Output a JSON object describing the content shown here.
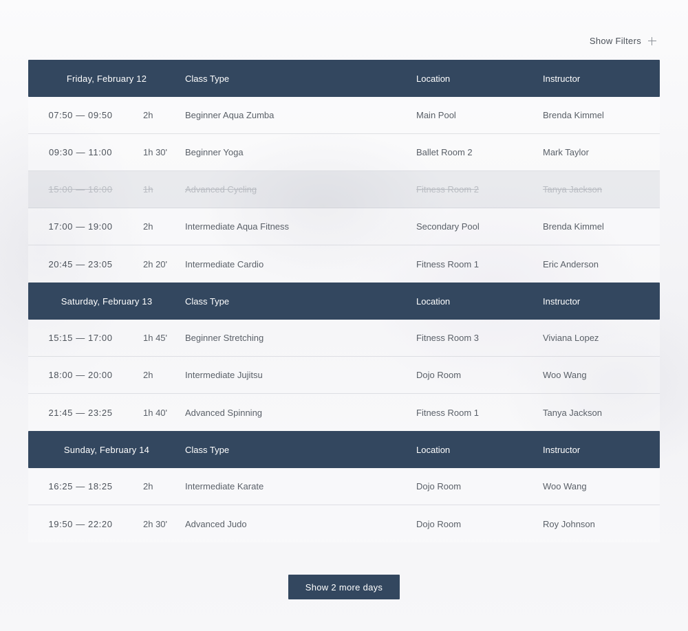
{
  "filters": {
    "label": "Show Filters",
    "icon": "plus-icon"
  },
  "columns": {
    "class_type": "Class Type",
    "location": "Location",
    "instructor": "Instructor"
  },
  "days": [
    {
      "date": "Friday, February 12",
      "classes": [
        {
          "time": "07:50 — 09:50",
          "duration": "2h",
          "type": "Beginner Aqua Zumba",
          "location": "Main Pool",
          "instructor": "Brenda Kimmel",
          "cancelled": false
        },
        {
          "time": "09:30 — 11:00",
          "duration": "1h 30'",
          "type": "Beginner Yoga",
          "location": "Ballet Room 2",
          "instructor": "Mark Taylor",
          "cancelled": false
        },
        {
          "time": "15:00 — 16:00",
          "duration": "1h",
          "type": "Advanced Cycling",
          "location": "Fitness Room 2",
          "instructor": "Tanya Jackson",
          "cancelled": true
        },
        {
          "time": "17:00 — 19:00",
          "duration": "2h",
          "type": "Intermediate Aqua Fitness",
          "location": "Secondary Pool",
          "instructor": "Brenda Kimmel",
          "cancelled": false
        },
        {
          "time": "20:45 — 23:05",
          "duration": "2h 20'",
          "type": "Intermediate Cardio",
          "location": "Fitness Room 1",
          "instructor": "Eric Anderson",
          "cancelled": false
        }
      ]
    },
    {
      "date": "Saturday, February 13",
      "classes": [
        {
          "time": "15:15 — 17:00",
          "duration": "1h 45'",
          "type": "Beginner Stretching",
          "location": "Fitness Room 3",
          "instructor": "Viviana Lopez",
          "cancelled": false
        },
        {
          "time": "18:00 — 20:00",
          "duration": "2h",
          "type": "Intermediate Jujitsu",
          "location": "Dojo Room",
          "instructor": "Woo Wang",
          "cancelled": false
        },
        {
          "time": "21:45 — 23:25",
          "duration": "1h 40'",
          "type": "Advanced Spinning",
          "location": "Fitness Room 1",
          "instructor": "Tanya Jackson",
          "cancelled": false
        }
      ]
    },
    {
      "date": "Sunday, February 14",
      "classes": [
        {
          "time": "16:25 — 18:25",
          "duration": "2h",
          "type": "Intermediate Karate",
          "location": "Dojo Room",
          "instructor": "Woo Wang",
          "cancelled": false
        },
        {
          "time": "19:50 — 22:20",
          "duration": "2h 30'",
          "type": "Advanced Judo",
          "location": "Dojo Room",
          "instructor": "Roy Johnson",
          "cancelled": false
        }
      ]
    }
  ],
  "more_button": {
    "label": "Show 2 more days"
  }
}
